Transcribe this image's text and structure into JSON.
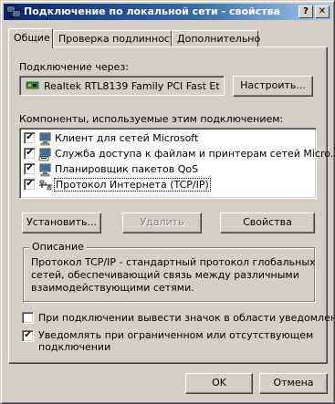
{
  "window": {
    "title": "Подключение по локальной сети - свойства",
    "help_button": "?",
    "close_button": "✕"
  },
  "tabs": [
    {
      "label": "Общие",
      "active": true
    },
    {
      "label": "Проверка подлинности",
      "active": false
    },
    {
      "label": "Дополнительно",
      "active": false
    }
  ],
  "connection": {
    "label": "Подключение через:",
    "adapter": "Realtek RTL8139 Family PCI Fast Et",
    "configure_button": "Настроить..."
  },
  "components": {
    "label": "Компоненты, используемые этим подключением:",
    "items": [
      {
        "label": "Клиент для сетей Microsoft",
        "checked": true,
        "icon": "network-client-icon"
      },
      {
        "label": "Служба доступа к файлам и принтерам сетей Micro...",
        "checked": true,
        "icon": "file-printer-sharing-icon"
      },
      {
        "label": "Планировщик пакетов QoS",
        "checked": true,
        "icon": "packet-scheduler-icon"
      },
      {
        "label": "Протокол Интернета (TCP/IP)",
        "checked": true,
        "icon": "protocol-icon",
        "selected": true
      }
    ],
    "install_button": "Установить...",
    "uninstall_button": "Удалить",
    "properties_button": "Свойства"
  },
  "description": {
    "title": "Описание",
    "text_lines": [
      "Протокол TCP/IP - стандартный протокол глобальных",
      "сетей, обеспечивающий связь между различными",
      "взаимодействующими сетями."
    ]
  },
  "options": {
    "show_icon_label": "При подключении вывести значок в области уведомлений",
    "show_icon_checked": false,
    "notify_label_lines": [
      "Уведомлять при ограниченном или отсутствующем",
      "подключении"
    ],
    "notify_checked": true
  },
  "footer": {
    "ok_button": "OK",
    "cancel_button": "Отмена"
  },
  "colors": {
    "face": "#d4d0c8",
    "title_start": "#0a246a",
    "title_end": "#a6caf0"
  }
}
